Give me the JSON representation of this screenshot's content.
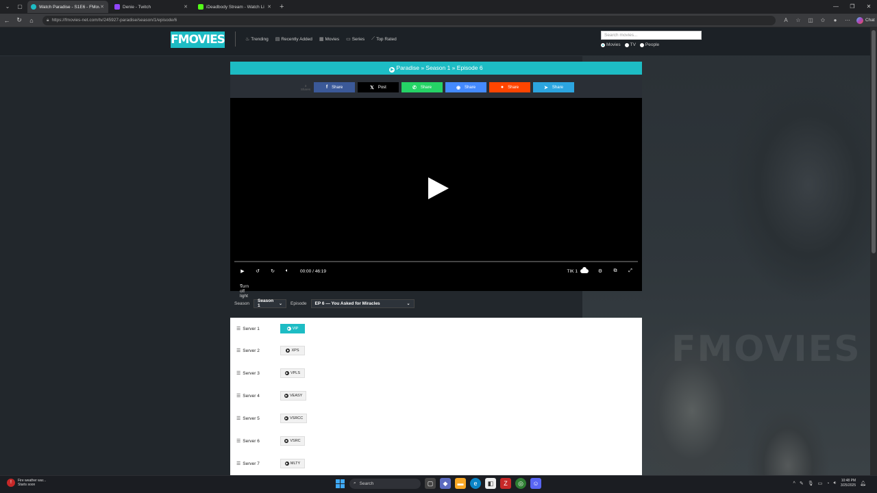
{
  "browser": {
    "tabs": [
      {
        "title": "Watch Paradise - S1E6 - FMovies",
        "active": true,
        "color": "#1dbcc4"
      },
      {
        "title": "Denie - Twitch",
        "active": false,
        "color": "#9146ff"
      },
      {
        "title": "iDeadbody Stream - Watch Li",
        "active": false,
        "color": "#53fc18"
      }
    ],
    "url": "https://fmovies-net.com/tv/245927-paradise/season/1/episode/6",
    "chat_label": "Chat"
  },
  "site": {
    "logo": "FMOVIES",
    "nav": [
      {
        "label": "Trending",
        "icon": "fire-icon"
      },
      {
        "label": "Recently Added",
        "icon": "list-icon"
      },
      {
        "label": "Movies",
        "icon": "film-icon"
      },
      {
        "label": "Series",
        "icon": "tv-icon"
      },
      {
        "label": "Top Rated",
        "icon": "chart-icon"
      }
    ],
    "search_placeholder": "Search movies...",
    "search_types": [
      "Movies",
      "TV",
      "People"
    ],
    "search_type_selected": "Movies",
    "accent": "#1dbcc4",
    "background_title": "FMOVIES"
  },
  "episode": {
    "title": "Paradise » Season 1 » Episode 6"
  },
  "share": {
    "count": "3",
    "count_label": "Shares",
    "buttons": [
      {
        "label": "Share",
        "icon": "f",
        "network": "facebook",
        "color": "#3b5998"
      },
      {
        "label": "Post",
        "icon": "𝕏",
        "network": "x",
        "color": "#000000"
      },
      {
        "label": "Share",
        "icon": "✆",
        "network": "whatsapp",
        "color": "#25d366"
      },
      {
        "label": "Share",
        "icon": "◉",
        "network": "messenger",
        "color": "#448aff"
      },
      {
        "label": "Share",
        "icon": "●",
        "network": "reddit",
        "color": "#ff4500"
      },
      {
        "label": "Share",
        "icon": "➤",
        "network": "telegram",
        "color": "#2ca5e0"
      }
    ]
  },
  "player": {
    "current_time": "00:00",
    "separator": "/",
    "duration": "46:19",
    "quality_label": "TIK 1",
    "progress": 0,
    "light_toggle": "Turn off light"
  },
  "selector": {
    "season_label": "Season",
    "season_value": "Season 1",
    "episode_label": "Episode",
    "episode_value": "EP 6 — You Asked for Miracles"
  },
  "servers": [
    {
      "name": "Server 1",
      "source": "VIP",
      "active": true
    },
    {
      "name": "Server 2",
      "source": "XPS",
      "active": false
    },
    {
      "name": "Server 3",
      "source": "VPLS",
      "active": false
    },
    {
      "name": "Server 4",
      "source": "VEASY",
      "active": false
    },
    {
      "name": "Server 5",
      "source": "VSRCC",
      "active": false
    },
    {
      "name": "Server 6",
      "source": "VSRC",
      "active": false
    },
    {
      "name": "Server 7",
      "source": "MLTY",
      "active": false
    }
  ],
  "taskbar": {
    "weather_line1": "Fire weather war...",
    "weather_line2": "Starts soon",
    "search_label": "Search",
    "time": "10:48 PM",
    "date": "3/25/2025"
  }
}
